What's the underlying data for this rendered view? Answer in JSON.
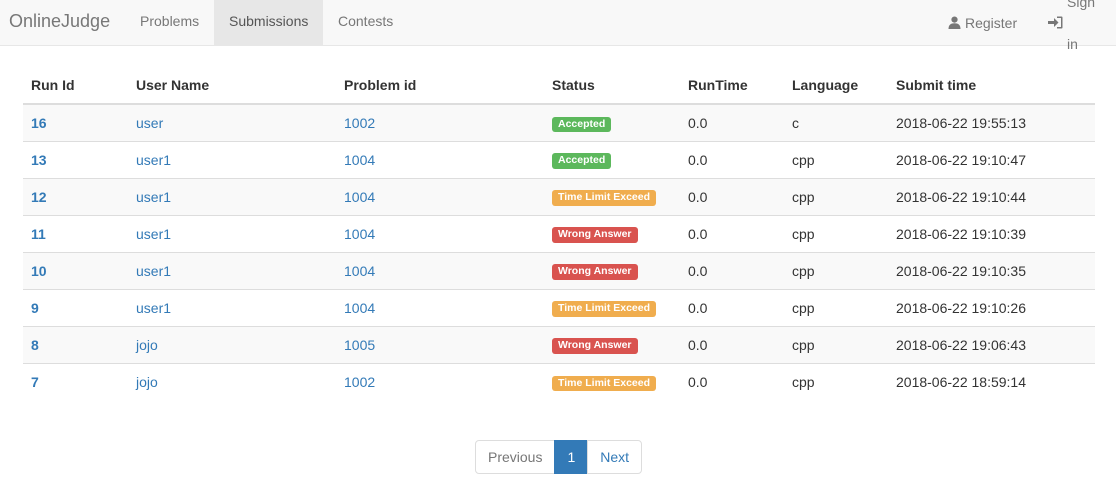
{
  "navbar": {
    "brand": "OnlineJudge",
    "items": [
      {
        "label": "Problems"
      },
      {
        "label": "Submissions",
        "active": true
      },
      {
        "label": "Contests"
      }
    ],
    "register_label": "Register",
    "signin_label": "Sign in",
    "register_icon": "user-icon",
    "signin_icon": "sign-in-icon"
  },
  "table": {
    "headers": [
      "Run Id",
      "User Name",
      "Problem id",
      "Status",
      "RunTime",
      "Language",
      "Submit time"
    ],
    "rows": [
      {
        "run_id": "16",
        "user": "user",
        "problem": "1002",
        "status": "Accepted",
        "status_type": "success",
        "runtime": "0.0",
        "language": "c",
        "time": "2018-06-22 19:55:13"
      },
      {
        "run_id": "13",
        "user": "user1",
        "problem": "1004",
        "status": "Accepted",
        "status_type": "success",
        "runtime": "0.0",
        "language": "cpp",
        "time": "2018-06-22 19:10:47"
      },
      {
        "run_id": "12",
        "user": "user1",
        "problem": "1004",
        "status": "Time Limit Exceed",
        "status_type": "warning",
        "runtime": "0.0",
        "language": "cpp",
        "time": "2018-06-22 19:10:44"
      },
      {
        "run_id": "11",
        "user": "user1",
        "problem": "1004",
        "status": "Wrong Answer",
        "status_type": "danger",
        "runtime": "0.0",
        "language": "cpp",
        "time": "2018-06-22 19:10:39"
      },
      {
        "run_id": "10",
        "user": "user1",
        "problem": "1004",
        "status": "Wrong Answer",
        "status_type": "danger",
        "runtime": "0.0",
        "language": "cpp",
        "time": "2018-06-22 19:10:35"
      },
      {
        "run_id": "9",
        "user": "user1",
        "problem": "1004",
        "status": "Time Limit Exceed",
        "status_type": "warning",
        "runtime": "0.0",
        "language": "cpp",
        "time": "2018-06-22 19:10:26"
      },
      {
        "run_id": "8",
        "user": "jojo",
        "problem": "1005",
        "status": "Wrong Answer",
        "status_type": "danger",
        "runtime": "0.0",
        "language": "cpp",
        "time": "2018-06-22 19:06:43"
      },
      {
        "run_id": "7",
        "user": "jojo",
        "problem": "1002",
        "status": "Time Limit Exceed",
        "status_type": "warning",
        "runtime": "0.0",
        "language": "cpp",
        "time": "2018-06-22 18:59:14"
      }
    ]
  },
  "pagination": {
    "previous_label": "Previous",
    "current_page": "1",
    "next_label": "Next"
  },
  "colors": {
    "link": "#337ab7",
    "success": "#5cb85c",
    "warning": "#f0ad4e",
    "danger": "#d9534f"
  }
}
